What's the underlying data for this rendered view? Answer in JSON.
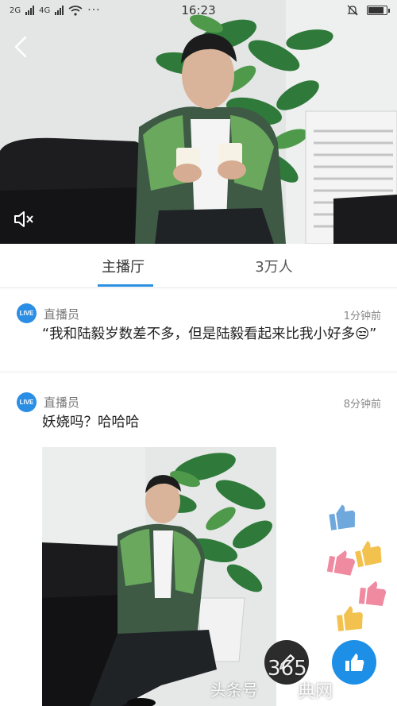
{
  "status_bar": {
    "network_a": "2G",
    "network_b": "4G",
    "time": "16:23",
    "battery_level": 0.85
  },
  "video": {
    "back_icon": "chevron-left-icon",
    "mute_icon": "speaker-muted-icon"
  },
  "tabs": [
    {
      "label": "主播厅",
      "active": true
    },
    {
      "label": "3万人",
      "active": false
    }
  ],
  "feed": [
    {
      "badge": "LIVE",
      "author": "直播员",
      "time": "1分钟前",
      "text": "“我和陆毅岁数差不多，但是陆毅看起来比我小好多😒”"
    },
    {
      "badge": "LIVE",
      "author": "直播员",
      "time": "8分钟前",
      "text": "妖娆吗？哈哈哈"
    }
  ],
  "overlays": {
    "watermark_left": "头条号",
    "watermark_mid": "365",
    "watermark_right": "典网"
  },
  "colors": {
    "accent": "#2a8fe0",
    "live_badge": "#2b8ee5",
    "fab_blue": "#1e8fe6",
    "fab_dark": "#2c2c2c"
  }
}
